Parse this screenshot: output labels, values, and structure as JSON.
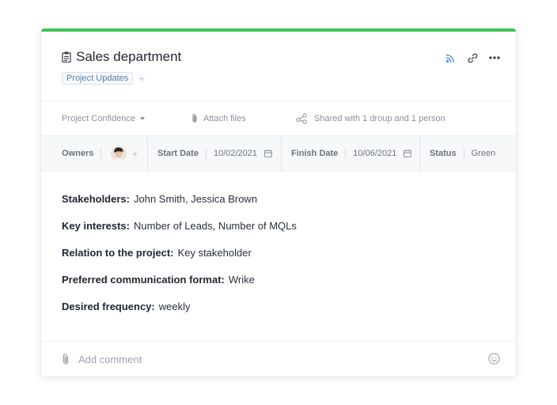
{
  "task": {
    "title": "Sales department",
    "tag": "Project Updates",
    "tag_add": "+"
  },
  "toolbar": {
    "confidence_label": "Project Confidence",
    "attach_label": "Attach files",
    "shared_label": "Shared with 1 droup and 1 person"
  },
  "fields": {
    "owners_label": "Owners",
    "owner_add": "+",
    "start_label": "Start Date",
    "start_value": "10/02/2021",
    "finish_label": "Finish Date",
    "finish_value": "10/06/2021",
    "status_label": "Status",
    "status_value": "Green"
  },
  "description": [
    {
      "label": "Stakeholders:",
      "value": "John Smith, Jessica Brown"
    },
    {
      "label": "Key interests:",
      "value": "Number of Leads, Number of MQLs"
    },
    {
      "label": "Relation to the project:",
      "value": "Key stakeholder"
    },
    {
      "label": "Preferred communication format:",
      "value": "Wrike"
    },
    {
      "label": "Desired frequency:",
      "value": "weekly"
    }
  ],
  "comment": {
    "placeholder": "Add comment"
  },
  "icons": {
    "doc": "document-icon",
    "rss": "rss-icon",
    "link": "link-icon",
    "more": "more-icon",
    "paperclip": "paperclip-icon",
    "share": "share-icon",
    "calendar": "calendar-icon",
    "smile": "emoji-icon"
  },
  "colors": {
    "accent_bar": "#3ec35b",
    "rss": "#4a90e2",
    "tag_text": "#5b7ea8"
  }
}
